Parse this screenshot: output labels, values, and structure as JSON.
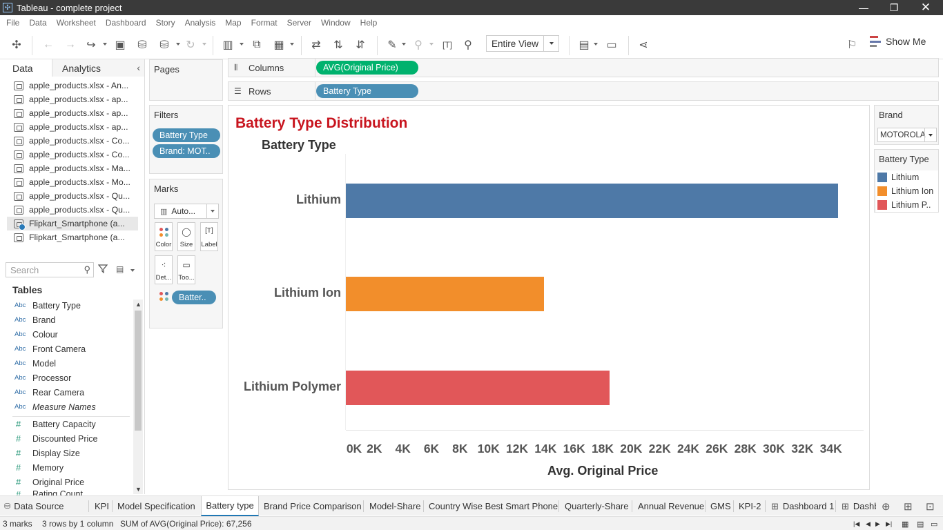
{
  "window": {
    "title": "Tableau - complete project"
  },
  "menu": [
    "File",
    "Data",
    "Worksheet",
    "Dashboard",
    "Story",
    "Analysis",
    "Map",
    "Format",
    "Server",
    "Window",
    "Help"
  ],
  "toolbar": {
    "fit": "Entire View",
    "show_me": "Show Me"
  },
  "data_pane": {
    "tabs": {
      "data": "Data",
      "analytics": "Analytics"
    },
    "sources": [
      {
        "label": "apple_products.xlsx - An...",
        "selected": false
      },
      {
        "label": "apple_products.xlsx - ap...",
        "selected": false
      },
      {
        "label": "apple_products.xlsx - ap...",
        "selected": false
      },
      {
        "label": "apple_products.xlsx - ap...",
        "selected": false
      },
      {
        "label": "apple_products.xlsx - Co...",
        "selected": false
      },
      {
        "label": "apple_products.xlsx - Co...",
        "selected": false
      },
      {
        "label": "apple_products.xlsx - Ma...",
        "selected": false
      },
      {
        "label": "apple_products.xlsx - Mo...",
        "selected": false
      },
      {
        "label": "apple_products.xlsx - Qu...",
        "selected": false
      },
      {
        "label": "apple_products.xlsx - Qu...",
        "selected": false
      },
      {
        "label": "Flipkart_Smartphone (a...",
        "selected": true
      },
      {
        "label": "Flipkart_Smartphone (a...",
        "selected": false
      }
    ],
    "search_placeholder": "Search",
    "tables_heading": "Tables",
    "dimension_type": "Abc",
    "measure_type": "#",
    "dimensions": [
      "Battery Type",
      "Brand",
      "Colour",
      "Front Camera",
      "Model",
      "Processor",
      "Rear Camera"
    ],
    "measure_names": "Measure Names",
    "measures": [
      "Battery Capacity",
      "Discounted Price",
      "Display Size",
      "Memory",
      "Original Price",
      "Rating Count"
    ]
  },
  "cards": {
    "pages": "Pages",
    "filters": {
      "title": "Filters",
      "pills": [
        "Battery Type",
        "Brand: MOT.."
      ]
    },
    "marks": {
      "title": "Marks",
      "type": "Auto...",
      "buttons": [
        "Color",
        "Size",
        "Label",
        "Det...",
        "Too..."
      ],
      "pill": "Batter.."
    }
  },
  "shelves": {
    "columns": {
      "label": "Columns",
      "pill": "AVG(Original Price)"
    },
    "rows": {
      "label": "Rows",
      "pill": "Battery Type"
    }
  },
  "view": {
    "title": "Battery Type Distribution"
  },
  "chart_data": {
    "type": "bar",
    "orientation": "horizontal",
    "title": "Battery Type Distribution",
    "row_header": "Battery Type",
    "xlabel": "Avg. Original Price",
    "categories": [
      "Lithium",
      "Lithium Ion",
      "Lithium Polymer"
    ],
    "values": [
      34500,
      13900,
      18500
    ],
    "colors": [
      "#4e79a7",
      "#f28e2b",
      "#e15759"
    ],
    "xlim": [
      0,
      34000
    ],
    "xticks": [
      "0K",
      "2K",
      "4K",
      "6K",
      "8K",
      "10K",
      "12K",
      "14K",
      "16K",
      "18K",
      "20K",
      "22K",
      "24K",
      "26K",
      "28K",
      "30K",
      "32K",
      "34K"
    ]
  },
  "legend": {
    "brand_filter": {
      "title": "Brand",
      "value": "MOTOROLA"
    },
    "color": {
      "title": "Battery Type",
      "items": [
        {
          "label": "Lithium",
          "color": "#4e79a7"
        },
        {
          "label": "Lithium Ion",
          "color": "#f28e2b"
        },
        {
          "label": "Lithium P..",
          "color": "#e15759"
        }
      ]
    }
  },
  "sheet_tabs": [
    "Data Source",
    "KPI",
    "Model Specification",
    "Battery type",
    "Brand Price Comparison",
    "Model-Share",
    "Country Wise Best Smart Phone",
    "Quarterly-Share",
    "Annual Revenue",
    "GMS",
    "KPI-2",
    "Dashboard 1",
    "Dashb"
  ],
  "active_tab": "Battery type",
  "status": {
    "marks": "3 marks",
    "dims": "3 rows by 1 column",
    "sum": "SUM of AVG(Original Price): 67,256"
  }
}
